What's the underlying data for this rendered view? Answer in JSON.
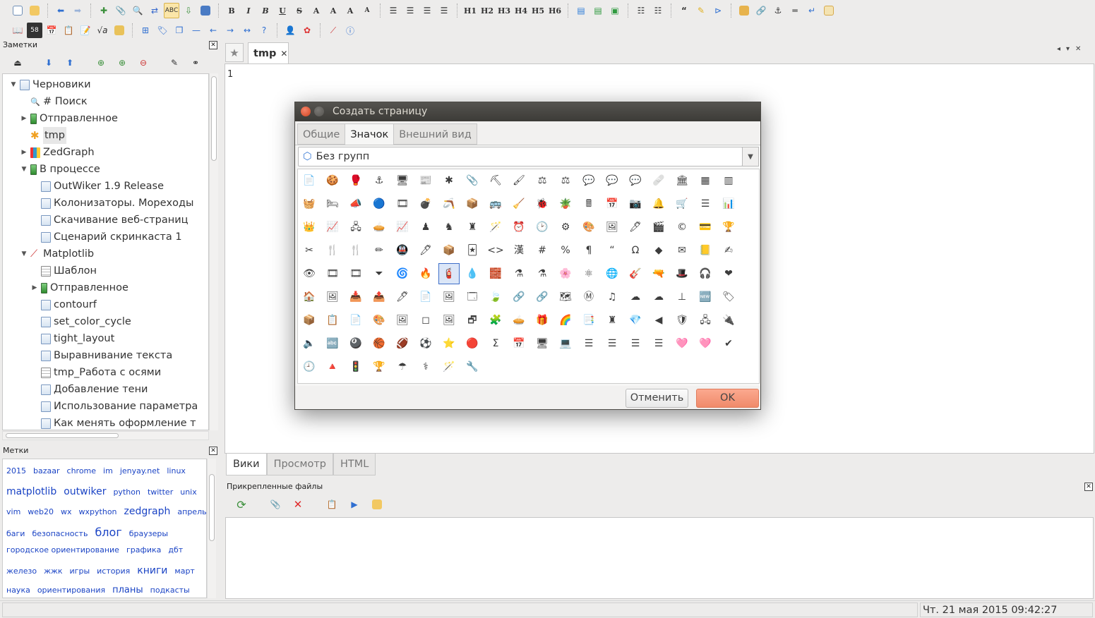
{
  "toolbar1": {
    "headings": [
      "H1",
      "H2",
      "H3",
      "H4",
      "H5",
      "H6"
    ],
    "text_buttons": [
      "B",
      "I",
      "B",
      "U",
      "S",
      "A",
      "A",
      "A",
      "A"
    ]
  },
  "notes_panel": {
    "title": "Заметки",
    "tree": [
      {
        "label": "Черновики",
        "level": 0,
        "arrow": "down",
        "icon": "page-icon"
      },
      {
        "label": "# Поиск",
        "level": 1,
        "arrow": "",
        "icon": "search-icon"
      },
      {
        "label": "Отправленное",
        "level": 1,
        "arrow": "right",
        "icon": "battery-icon"
      },
      {
        "label": "tmp",
        "level": 1,
        "arrow": "",
        "icon": "asterisk-icon",
        "selected": true
      },
      {
        "label": "ZedGraph",
        "level": 1,
        "arrow": "right",
        "icon": "chart-icon"
      },
      {
        "label": "В процессе",
        "level": 1,
        "arrow": "down",
        "icon": "battery-icon"
      },
      {
        "label": "OutWiker 1.9 Release",
        "level": 2,
        "arrow": "",
        "icon": "page-icon"
      },
      {
        "label": "Колонизаторы. Мореходы",
        "level": 2,
        "arrow": "",
        "icon": "page-icon"
      },
      {
        "label": "Скачивание веб-страниц",
        "level": 2,
        "arrow": "",
        "icon": "page-icon"
      },
      {
        "label": "Сценарий скринкаста 1",
        "level": 2,
        "arrow": "",
        "icon": "page-icon"
      },
      {
        "label": "Matplotlib",
        "level": 1,
        "arrow": "down",
        "icon": "line-chart-icon"
      },
      {
        "label": "Шаблон",
        "level": 2,
        "arrow": "",
        "icon": "template-icon"
      },
      {
        "label": "Отправленное",
        "level": 2,
        "arrow": "right",
        "icon": "battery-icon"
      },
      {
        "label": "contourf",
        "level": 2,
        "arrow": "",
        "icon": "page-icon"
      },
      {
        "label": "set_color_cycle",
        "level": 2,
        "arrow": "",
        "icon": "page-icon"
      },
      {
        "label": "tight_layout",
        "level": 2,
        "arrow": "",
        "icon": "page-icon"
      },
      {
        "label": "Выравнивание текста",
        "level": 2,
        "arrow": "",
        "icon": "page-icon"
      },
      {
        "label": "tmp_Работа с осями",
        "level": 2,
        "arrow": "",
        "icon": "template-icon"
      },
      {
        "label": "Добавление тени",
        "level": 2,
        "arrow": "",
        "icon": "page-icon"
      },
      {
        "label": "Использование параметра",
        "level": 2,
        "arrow": "",
        "icon": "page-icon"
      },
      {
        "label": "Как менять оформление т",
        "level": 2,
        "arrow": "",
        "icon": "page-icon"
      }
    ]
  },
  "tags_panel": {
    "title": "Метки",
    "rows": [
      [
        {
          "t": "2015",
          "s": 11
        },
        {
          "t": "bazaar",
          "s": 11
        },
        {
          "t": "chrome",
          "s": 11
        },
        {
          "t": "im",
          "s": 11
        },
        {
          "t": "jenyay.net",
          "s": 11
        },
        {
          "t": "linux",
          "s": 11
        }
      ],
      [
        {
          "t": "matplotlib",
          "s": 14
        },
        {
          "t": "outwiker",
          "s": 14
        },
        {
          "t": "python",
          "s": 11
        },
        {
          "t": "twitter",
          "s": 11
        },
        {
          "t": "unix",
          "s": 11
        }
      ],
      [
        {
          "t": "vim",
          "s": 11
        },
        {
          "t": "web20",
          "s": 11
        },
        {
          "t": "wx",
          "s": 11
        },
        {
          "t": "wxpython",
          "s": 11
        },
        {
          "t": "zedgraph",
          "s": 14
        },
        {
          "t": "апрель",
          "s": 11
        }
      ],
      [
        {
          "t": "баги",
          "s": 11
        },
        {
          "t": "безопасность",
          "s": 11
        },
        {
          "t": "блог",
          "s": 16
        },
        {
          "t": "браузеры",
          "s": 11
        }
      ],
      [
        {
          "t": "городское ориентирование",
          "s": 11
        },
        {
          "t": "графика",
          "s": 11
        },
        {
          "t": "дбт",
          "s": 11
        }
      ],
      [
        {
          "t": "железо",
          "s": 11
        },
        {
          "t": "жжк",
          "s": 11
        },
        {
          "t": "игры",
          "s": 11
        },
        {
          "t": "история",
          "s": 11
        },
        {
          "t": "книги",
          "s": 14
        },
        {
          "t": "март",
          "s": 11
        }
      ],
      [
        {
          "t": "наука",
          "s": 11
        },
        {
          "t": "ориентирования",
          "s": 11
        },
        {
          "t": "планы",
          "s": 13
        },
        {
          "t": "подкасты",
          "s": 11
        }
      ]
    ]
  },
  "editor": {
    "tab_title": "tmp",
    "line_number": "1",
    "bottom_tabs": [
      "Вики",
      "Просмотр",
      "HTML"
    ]
  },
  "attachments": {
    "title": "Прикрепленные файлы"
  },
  "status": {
    "datetime": "Чт. 21 мая 2015 09:42:27"
  },
  "dialog": {
    "title": "Создать страницу",
    "tabs": [
      "Общие",
      "Значок",
      "Внешний вид"
    ],
    "active_tab": 1,
    "group": "Без групп",
    "icons": [
      [
        "📄",
        "🍪",
        "🥊",
        "⚓",
        "🖥",
        "📰",
        "✱",
        "📎",
        "⛏",
        "🖌",
        "⚖",
        "⚖",
        "💬",
        "💬",
        "💬",
        "🩹",
        "🏛",
        "▦",
        "▥"
      ],
      [
        "🧺",
        "🛏",
        "📣",
        "🔵",
        "🎞",
        "💣",
        "🪃",
        "📦",
        "🚌",
        "🧹",
        "🐞",
        "🪴",
        "🖩",
        "📅",
        "📷",
        "🔔",
        "🛒",
        "☰",
        "📊"
      ],
      [
        "👑",
        "📈",
        "🖧",
        "🥧",
        "📈",
        "♟",
        "♞",
        "♜",
        "🪄",
        "⏰",
        "🕑",
        "⚙",
        "🎨",
        "🖼",
        "🖊",
        "🎬",
        "©",
        "💳",
        "🏆"
      ],
      [
        "✂",
        "🍴",
        "🍴",
        "✏",
        "🚇",
        "🖊",
        "📦",
        "🃏",
        "<>",
        "漢",
        "#",
        "%",
        "¶",
        "“",
        "Ω",
        "◆",
        "✉",
        "📒",
        "✍"
      ],
      [
        "👁",
        "🎞",
        "🎞",
        "⏷",
        "🌀",
        "🔥",
        "🧯",
        "💧",
        "🧱",
        "⚗",
        "⚗",
        "🌸",
        "⚛",
        "🌐",
        "🎸",
        "🔫",
        "🎩",
        "🎧",
        "❤"
      ],
      [
        "🏠",
        "🖼",
        "📥",
        "📤",
        "🖊",
        "📄",
        "🖼",
        "🗔",
        "🍃",
        "🔗",
        "🔗",
        "🗺",
        "Ⓜ",
        "♫",
        "☁",
        "☁",
        "⊥",
        "🆕",
        "🏷"
      ],
      [
        "📦",
        "📋",
        "📄",
        "🎨",
        "🖼",
        "◻",
        "🖼",
        "🗗",
        "🧩",
        "🥧",
        "🎁",
        "🌈",
        "📑",
        "♜",
        "💎",
        "◀",
        "🛡",
        "🖧",
        "🔌"
      ],
      [
        "🔈",
        "🔤",
        "🎱",
        "🏀",
        "🏈",
        "⚽",
        "⭐",
        "🔴",
        "Σ",
        "📅",
        "🖥",
        "💻",
        "☰",
        "☰",
        "☰",
        "☰",
        "🩷",
        "🩷",
        "✔"
      ],
      [
        "🕘",
        "🔺",
        "🚦",
        "🏆",
        "☂",
        "⚕",
        "🪄",
        "🔧"
      ]
    ],
    "selected_icon": {
      "row": 4,
      "col": 6
    },
    "cancel_label": "Отменить",
    "ok_label": "OK"
  }
}
